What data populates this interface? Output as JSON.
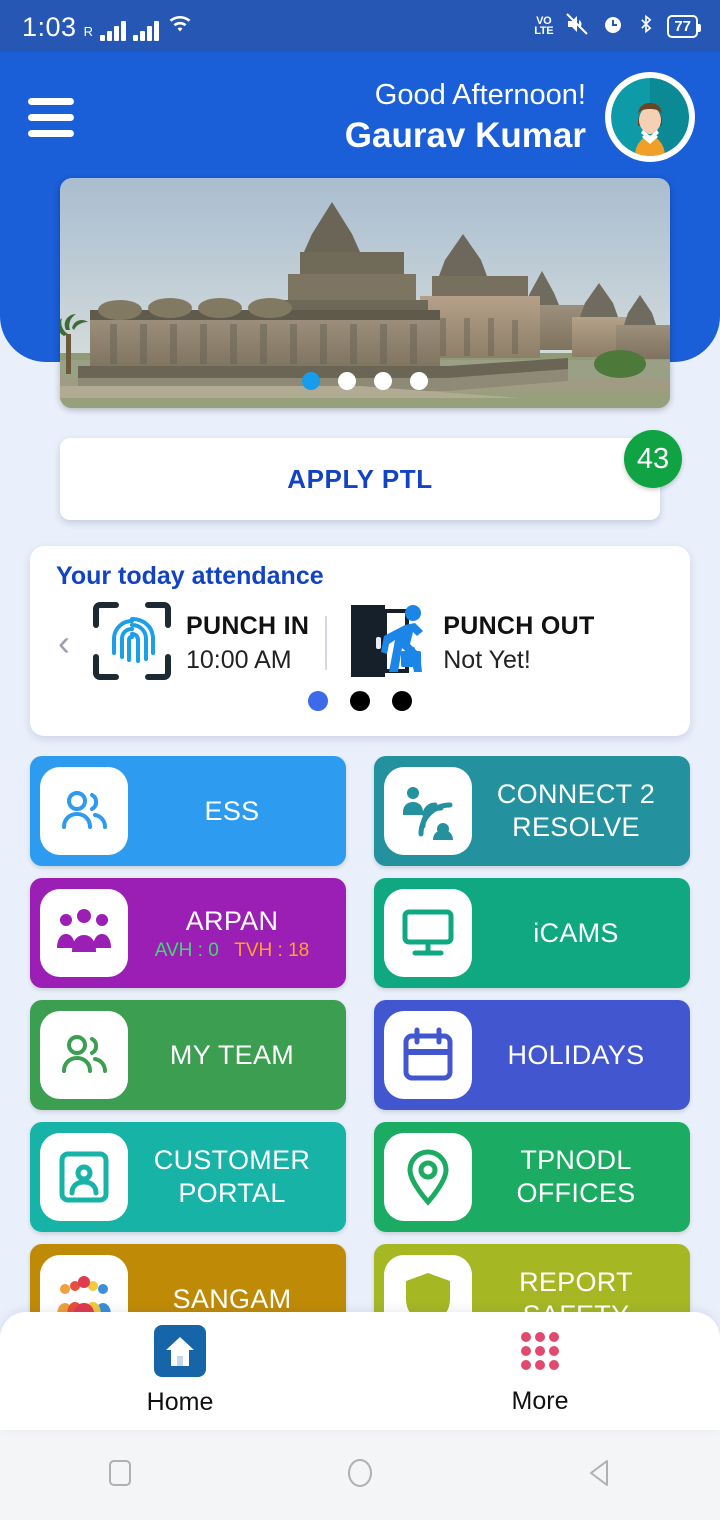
{
  "statusbar": {
    "time": "1:03",
    "roaming": "R",
    "volte_line1": "VO",
    "volte_line2": "LTE",
    "battery": "77",
    "icons": [
      "signal-bars-icon",
      "signal-bars-icon",
      "wifi-icon",
      "volte-icon",
      "mute-icon",
      "alarm-icon",
      "bluetooth-icon",
      "battery-icon"
    ]
  },
  "header": {
    "menu_icon": "hamburger-menu-icon",
    "greeting": "Good Afternoon!",
    "user_name": "Gaurav Kumar",
    "avatar_icon": "user-avatar"
  },
  "carousel": {
    "alt": "temple-banner-image",
    "slide_count": 4,
    "active_index": 0
  },
  "apply_ptl": {
    "label": "APPLY PTL",
    "badge_count": "43",
    "badge_color": "#0fa343",
    "label_color": "#1243c4"
  },
  "attendance": {
    "title": "Your today attendance",
    "prev_arrow": "‹",
    "punch_in": {
      "label": "PUNCH IN",
      "value": "10:00 AM",
      "icon": "fingerprint-scan-icon"
    },
    "punch_out": {
      "label": "PUNCH OUT",
      "value": "Not Yet!",
      "icon": "person-exit-door-icon"
    },
    "dot_count": 3,
    "active_dot": 0
  },
  "tiles": [
    {
      "label": "ESS",
      "icon": "two-people-icon",
      "color": "#2c9bf0",
      "icon_color": "#2c9bf0",
      "sub": null
    },
    {
      "label": "CONNECT 2 RESOLVE",
      "icon": "support-signal-icon",
      "color": "#24919e",
      "icon_color": "#24919e",
      "sub": null
    },
    {
      "label": "ARPAN",
      "icon": "group-people-icon",
      "color": "#9c1fb5",
      "icon_color": "#9c1fb5",
      "sub": {
        "avh_label": "AVH : 0",
        "tvh_label": "TVH : 18",
        "avh_color": "#3ddc6e",
        "tvh_color": "#ffa227"
      }
    },
    {
      "label": "iCAMS",
      "icon": "monitor-icon",
      "color": "#0fa880",
      "icon_color": "#0fa880",
      "sub": null
    },
    {
      "label": "MY TEAM",
      "icon": "two-people-icon",
      "color": "#3c9e50",
      "icon_color": "#3c9e50",
      "sub": null
    },
    {
      "label": "HOLIDAYS",
      "icon": "calendar-icon",
      "color": "#4257cf",
      "icon_color": "#4257cf",
      "sub": null
    },
    {
      "label": "CUSTOMER PORTAL",
      "icon": "id-card-icon",
      "color": "#17b3a6",
      "icon_color": "#17b3a6",
      "sub": null
    },
    {
      "label": "TPNODL OFFICES",
      "icon": "map-pin-icon",
      "color": "#1bab62",
      "icon_color": "#1bab62",
      "sub": null
    },
    {
      "label": "SANGAM",
      "icon": "community-people-icon",
      "color": "#bf8a06",
      "icon_color": "#bf8a06",
      "sub": null
    },
    {
      "label": "REPORT SAFETY",
      "icon": "shield-icon",
      "color": "#a5b824",
      "icon_color": "#a5b824",
      "sub": null
    }
  ],
  "bottom_nav": [
    {
      "label": "Home",
      "icon": "home-icon",
      "color": "#1565a8",
      "active": true
    },
    {
      "label": "More",
      "icon": "grid-dots-icon",
      "color": "#e04a6e",
      "active": false
    }
  ],
  "system_nav": [
    "recents-square-icon",
    "home-circle-icon",
    "back-triangle-icon"
  ]
}
